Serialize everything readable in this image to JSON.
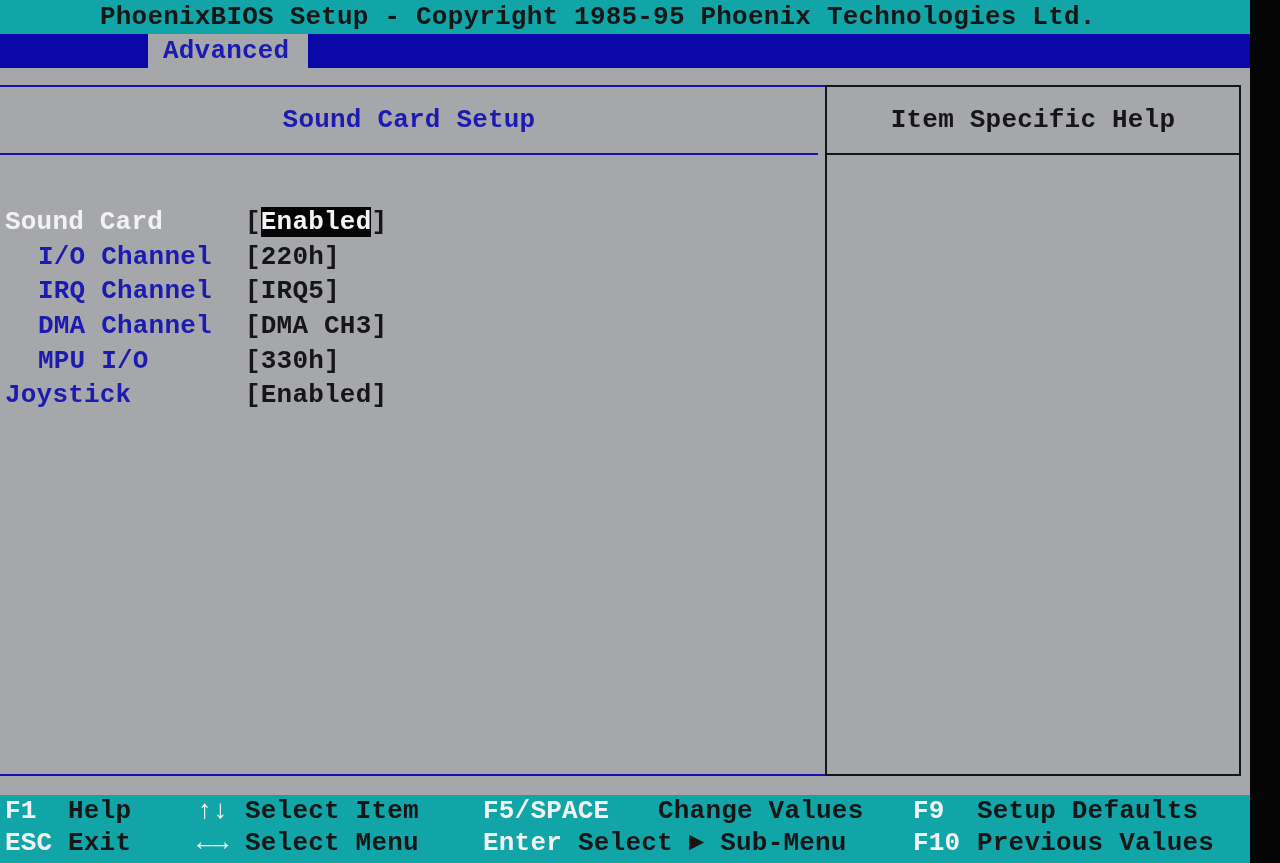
{
  "title_bar": {
    "title": "PhoenixBIOS Setup - Copyright 1985-95 Phoenix Technologies Ltd."
  },
  "menu_bar": {
    "tabs": [
      {
        "label": "Advanced",
        "selected": true
      }
    ]
  },
  "settings_panel": {
    "title": "Sound Card Setup",
    "items": [
      {
        "label": "Sound Card",
        "value": "[Enabled]",
        "selected": true,
        "children": [
          {
            "label": "I/O Channel",
            "value": "[220h]",
            "selected": false
          },
          {
            "label": "IRQ Channel",
            "value": "[IRQ5]",
            "selected": false
          },
          {
            "label": "DMA Channel",
            "value": "[DMA CH3]",
            "selected": false
          },
          {
            "label": "MPU I/O",
            "value": "[330h]",
            "selected": false
          }
        ]
      },
      {
        "label": "Joystick",
        "value": "[Enabled]",
        "selected": false
      }
    ]
  },
  "help_panel": {
    "title": "Item Specific Help"
  },
  "key_help": [
    {
      "items": [
        {
          "key": "F1",
          "description": "Help"
        },
        {
          "key": "↑↓",
          "description": "Select Item"
        },
        {
          "key": "F5/SPACE",
          "description": "Change Values"
        },
        {
          "key": "F9",
          "description": "Setup Defaults"
        }
      ]
    },
    {
      "items": [
        {
          "key": "ESC",
          "description": "Exit"
        },
        {
          "key": "←→",
          "description": "Select Menu"
        },
        {
          "key": "Enter",
          "description": "Select ► Sub-Menu"
        },
        {
          "key": "F10",
          "description": "Previous Values"
        }
      ]
    }
  ]
}
